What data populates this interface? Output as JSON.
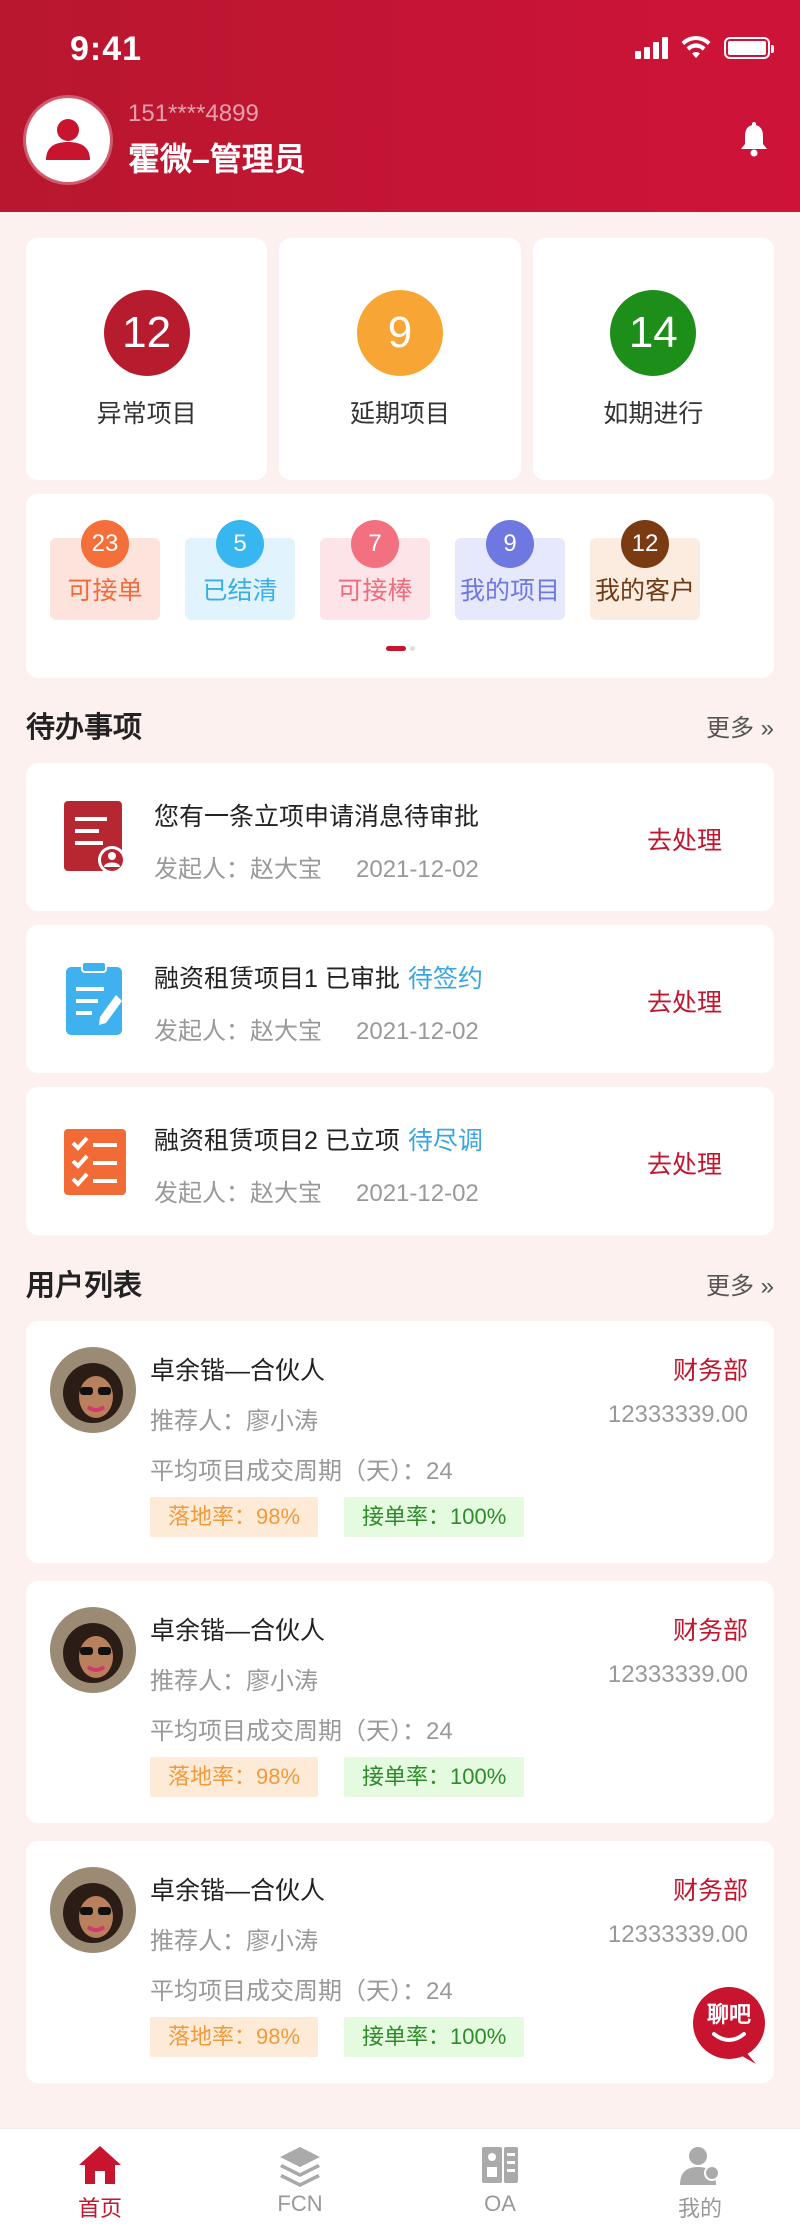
{
  "status_bar": {
    "time": "9:41"
  },
  "profile": {
    "phone": "151****4899",
    "name": "霍微–管理员"
  },
  "colors": {
    "brand": "#c8142f",
    "abnormal": "#b71c2e",
    "delayed": "#f7a534",
    "ontime": "#1e8e1a"
  },
  "stats": [
    {
      "value": "12",
      "label": "异常项目",
      "color": "#b71c2e"
    },
    {
      "value": "9",
      "label": "延期项目",
      "color": "#f7a534"
    },
    {
      "value": "14",
      "label": "如期进行",
      "color": "#1e8e1a"
    }
  ],
  "quick": [
    {
      "count": "23",
      "label": "可接单",
      "badge": "#f46f3a",
      "bg": "#fde3dc",
      "fg": "#f16b3a"
    },
    {
      "count": "5",
      "label": "已结清",
      "badge": "#37b6ef",
      "bg": "#e1f3fd",
      "fg": "#39aee8"
    },
    {
      "count": "7",
      "label": "可接棒",
      "badge": "#f2707f",
      "bg": "#fde4e8",
      "fg": "#ee6c7c"
    },
    {
      "count": "9",
      "label": "我的项目",
      "badge": "#6f78e0",
      "bg": "#e6e8fb",
      "fg": "#6f78e0"
    },
    {
      "count": "12",
      "label": "我的客户",
      "badge": "#7a3a12",
      "bg": "#fcecdf",
      "fg": "#6e3b18"
    }
  ],
  "todo": {
    "title": "待办事项",
    "more": "更多 »",
    "items": [
      {
        "title": "您有一条立项申请消息待审批",
        "tag": "",
        "initiator": "发起人：赵大宝",
        "date": "2021-12-02",
        "action": "去处理",
        "icon": "approval-doc-icon"
      },
      {
        "title": "融资租赁项目1 已审批",
        "tag": "待签约",
        "initiator": "发起人：赵大宝",
        "date": "2021-12-02",
        "action": "去处理",
        "icon": "clipboard-sign-icon"
      },
      {
        "title": "融资租赁项目2 已立项",
        "tag": "待尽调",
        "initiator": "发起人：赵大宝",
        "date": "2021-12-02",
        "action": "去处理",
        "icon": "checklist-icon"
      }
    ]
  },
  "users": {
    "title": "用户列表",
    "more": "更多 »",
    "items": [
      {
        "name": "卓余锴—合伙人",
        "dept": "财务部",
        "referrer": "推荐人：廖小涛",
        "amount": "12333339.00",
        "cycle": "平均项目成交周期（天）：24",
        "land_rate": "落地率：98%",
        "accept_rate": "接单率：100%"
      },
      {
        "name": "卓余锴—合伙人",
        "dept": "财务部",
        "referrer": "推荐人：廖小涛",
        "amount": "12333339.00",
        "cycle": "平均项目成交周期（天）：24",
        "land_rate": "落地率：98%",
        "accept_rate": "接单率：100%"
      },
      {
        "name": "卓余锴—合伙人",
        "dept": "财务部",
        "referrer": "推荐人：廖小涛",
        "amount": "12333339.00",
        "cycle": "平均项目成交周期（天）：24",
        "land_rate": "落地率：98%",
        "accept_rate": "接单率：100%"
      }
    ]
  },
  "chat_fab": {
    "label": "聊吧"
  },
  "tabs": [
    {
      "label": "首页",
      "icon": "home-icon",
      "active": true
    },
    {
      "label": "FCN",
      "icon": "layers-icon",
      "active": false
    },
    {
      "label": "OA",
      "icon": "oa-icon",
      "active": false
    },
    {
      "label": "我的",
      "icon": "user-icon",
      "active": false
    }
  ]
}
